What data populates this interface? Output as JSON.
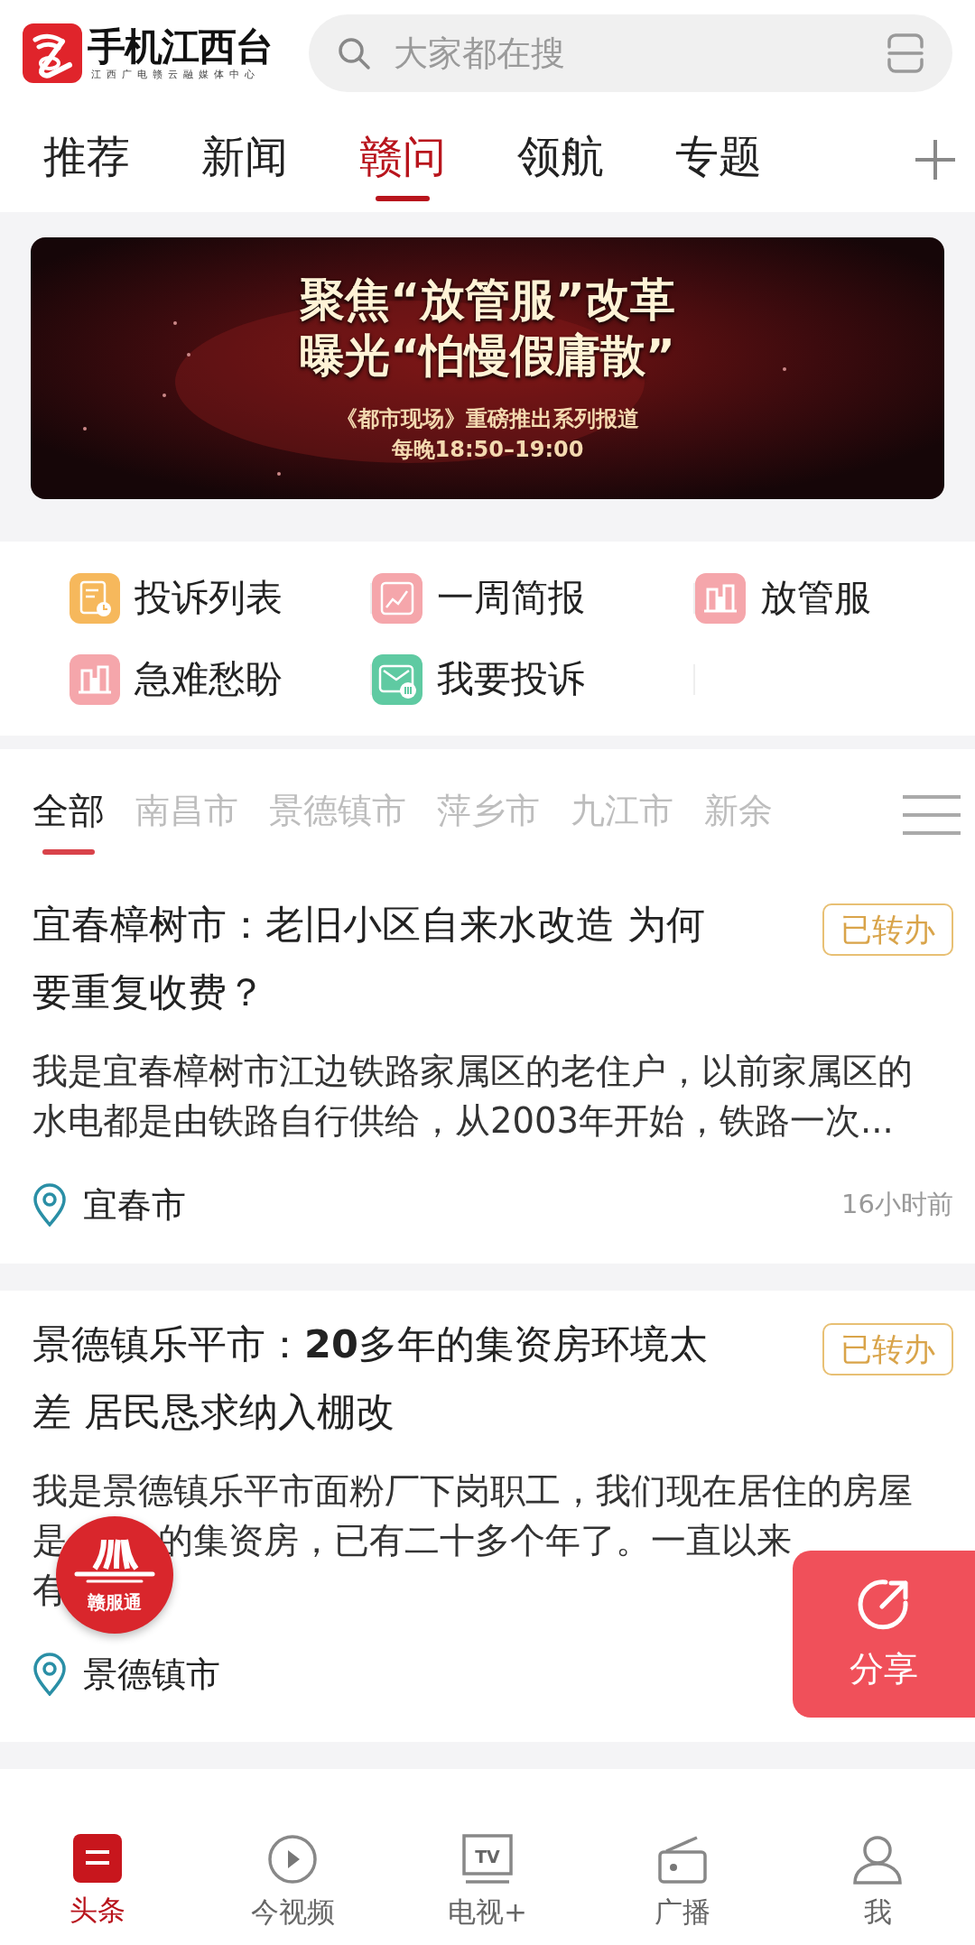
{
  "header": {
    "logo": {
      "title": "手机江西台",
      "subtitle": "江西广电赣云融媒体中心"
    },
    "search": {
      "placeholder": "大家都在搜"
    }
  },
  "channel_tabs": [
    {
      "label": "推荐",
      "selected": false
    },
    {
      "label": "新闻",
      "selected": false
    },
    {
      "label": "赣问",
      "selected": true
    },
    {
      "label": "领航",
      "selected": false
    },
    {
      "label": "专题",
      "selected": false
    }
  ],
  "banner": {
    "headline_lines": [
      "聚焦“放管服”改革",
      "曝光“怕慢假庸散”"
    ],
    "caption_lines": [
      "《都市现场》重磅推出系列报道",
      "每晚18:50–19:00"
    ]
  },
  "shortcuts": [
    {
      "label": "投诉列表",
      "kind": "document",
      "color": "#f6b85c"
    },
    {
      "label": "一周简报",
      "kind": "chart",
      "color": "#f5a6ab"
    },
    {
      "label": "放管服",
      "kind": "building",
      "color": "#f5a6ab"
    },
    {
      "label": "急难愁盼",
      "kind": "building",
      "color": "#f5a6ab"
    },
    {
      "label": "我要投诉",
      "kind": "mail",
      "color": "#5fcaa2"
    }
  ],
  "region_tabs": [
    {
      "label": "全部",
      "selected": true
    },
    {
      "label": "南昌市",
      "selected": false
    },
    {
      "label": "景德镇市",
      "selected": false
    },
    {
      "label": "萍乡市",
      "selected": false
    },
    {
      "label": "九江市",
      "selected": false
    },
    {
      "label": "新余",
      "selected": false
    }
  ],
  "articles": [
    {
      "title": "宜春樟树市：老旧小区自来水改造 为何要重复收费？",
      "status": "已转办",
      "description_lines": [
        [
          "我是宜春樟树市江边铁路家属区的老住户，以前家属区的"
        ],
        [
          "水电都是由铁路自行供给，从2003年开始，铁路一次..."
        ]
      ],
      "location": "宜春市",
      "time": "16小时前"
    },
    {
      "title": "景德镇乐平市：**20**多年的集资房环境太差 居民恳求纳入棚改",
      "status": "已转办",
      "description_lines": [
        [
          "我是景德镇乐平市面粉厂下岗职工，我们现在居住的房屋"
        ],
        [
          "是",
          "的集资房，已有二十多个年了。一直以来"
        ],
        [
          "有"
        ]
      ],
      "location": "景德镇市"
    }
  ],
  "floating": {
    "service_badge": {
      "label": "赣服通"
    },
    "share_button": {
      "label": "分享"
    }
  },
  "bottom_nav": [
    {
      "label": "头条",
      "kind": "headline",
      "selected": true
    },
    {
      "label": "今视频",
      "kind": "video",
      "selected": false
    },
    {
      "label": "电视+",
      "kind": "tv",
      "icon_text": "TV",
      "selected": false
    },
    {
      "label": "广播",
      "kind": "radio",
      "selected": false
    },
    {
      "label": "我",
      "kind": "person",
      "selected": false
    }
  ]
}
